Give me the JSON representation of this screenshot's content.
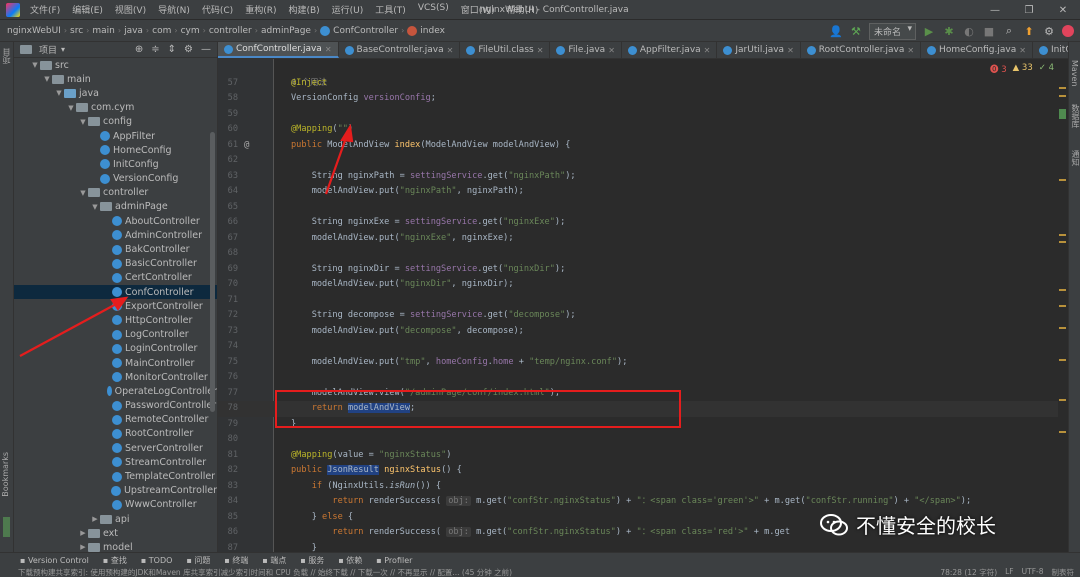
{
  "menu": [
    "文件(F)",
    "编辑(E)",
    "视图(V)",
    "导航(N)",
    "代码(C)",
    "重构(R)",
    "构建(B)",
    "运行(U)",
    "工具(T)",
    "VCS(S)",
    "窗口(W)",
    "帮助(H)"
  ],
  "window_title": "nginxWebUI - ConfController.java",
  "breadcrumb": [
    "nginxWebUI",
    "src",
    "main",
    "java",
    "com",
    "cym",
    "controller",
    "adminPage",
    "ConfController",
    "index"
  ],
  "run_config": "未命名",
  "project_panel": {
    "title": "项目",
    "tree": [
      {
        "label": "src",
        "indent": 1,
        "type": "folder",
        "open": true
      },
      {
        "label": "main",
        "indent": 2,
        "type": "folder",
        "open": true
      },
      {
        "label": "java",
        "indent": 3,
        "type": "srcfolder",
        "open": true
      },
      {
        "label": "com.cym",
        "indent": 4,
        "type": "package",
        "open": true
      },
      {
        "label": "config",
        "indent": 5,
        "type": "package",
        "open": true
      },
      {
        "label": "AppFilter",
        "indent": 6,
        "type": "class"
      },
      {
        "label": "HomeConfig",
        "indent": 6,
        "type": "class"
      },
      {
        "label": "InitConfig",
        "indent": 6,
        "type": "class"
      },
      {
        "label": "VersionConfig",
        "indent": 6,
        "type": "class"
      },
      {
        "label": "controller",
        "indent": 5,
        "type": "package",
        "open": true
      },
      {
        "label": "adminPage",
        "indent": 6,
        "type": "package",
        "open": true
      },
      {
        "label": "AboutController",
        "indent": 7,
        "type": "class"
      },
      {
        "label": "AdminController",
        "indent": 7,
        "type": "class"
      },
      {
        "label": "BakController",
        "indent": 7,
        "type": "class"
      },
      {
        "label": "BasicController",
        "indent": 7,
        "type": "class"
      },
      {
        "label": "CertController",
        "indent": 7,
        "type": "class"
      },
      {
        "label": "ConfController",
        "indent": 7,
        "type": "class",
        "selected": true
      },
      {
        "label": "ExportController",
        "indent": 7,
        "type": "class"
      },
      {
        "label": "HttpController",
        "indent": 7,
        "type": "class"
      },
      {
        "label": "LogController",
        "indent": 7,
        "type": "class"
      },
      {
        "label": "LoginController",
        "indent": 7,
        "type": "class"
      },
      {
        "label": "MainController",
        "indent": 7,
        "type": "class"
      },
      {
        "label": "MonitorController",
        "indent": 7,
        "type": "class"
      },
      {
        "label": "OperateLogController",
        "indent": 7,
        "type": "class"
      },
      {
        "label": "PasswordController",
        "indent": 7,
        "type": "class"
      },
      {
        "label": "RemoteController",
        "indent": 7,
        "type": "class"
      },
      {
        "label": "RootController",
        "indent": 7,
        "type": "class"
      },
      {
        "label": "ServerController",
        "indent": 7,
        "type": "class"
      },
      {
        "label": "StreamController",
        "indent": 7,
        "type": "class"
      },
      {
        "label": "TemplateController",
        "indent": 7,
        "type": "class"
      },
      {
        "label": "UpstreamController",
        "indent": 7,
        "type": "class"
      },
      {
        "label": "WwwController",
        "indent": 7,
        "type": "class"
      },
      {
        "label": "api",
        "indent": 6,
        "type": "package",
        "open": false
      },
      {
        "label": "ext",
        "indent": 5,
        "type": "package",
        "open": false
      },
      {
        "label": "model",
        "indent": 5,
        "type": "package",
        "open": false
      }
    ]
  },
  "tabs": [
    {
      "label": "ConfController.java",
      "active": true,
      "icon": "class"
    },
    {
      "label": "BaseController.java",
      "icon": "class"
    },
    {
      "label": "FileUtil.class",
      "icon": "class"
    },
    {
      "label": "File.java",
      "icon": "class"
    },
    {
      "label": "AppFilter.java",
      "icon": "class"
    },
    {
      "label": "JarUtil.java",
      "icon": "class"
    },
    {
      "label": "RootController.java",
      "icon": "class"
    },
    {
      "label": "HomeConfig.java",
      "icon": "class"
    },
    {
      "label": "InitC",
      "icon": "class"
    }
  ],
  "inspections": {
    "errors": "3",
    "warnings": "33",
    "weak": "4"
  },
  "usage_hint": "4 个用法",
  "code_lines": [
    {
      "n": "57",
      "html": "<span class='ann'>@Inject</span>"
    },
    {
      "n": "58",
      "html": "VersionConfig <span class='var'>versionConfig</span>;"
    },
    {
      "n": "59",
      "html": ""
    },
    {
      "n": "60",
      "html": "<span class='ann'>@Mapping</span>(<span class='str'>\"\"</span>)"
    },
    {
      "n": "61",
      "html": "<span class='kw'>public</span> ModelAndView <span class='fn'>index</span>(ModelAndView modelAndView) {",
      "gutter": "@"
    },
    {
      "n": "62",
      "html": ""
    },
    {
      "n": "63",
      "html": "    String nginxPath = <span class='var'>settingService</span>.get(<span class='str'>\"nginxPath\"</span>);"
    },
    {
      "n": "64",
      "html": "    modelAndView.put(<span class='str'>\"nginxPath\"</span>, nginxPath);"
    },
    {
      "n": "65",
      "html": ""
    },
    {
      "n": "66",
      "html": "    String nginxExe = <span class='var'>settingService</span>.get(<span class='str'>\"nginxExe\"</span>);"
    },
    {
      "n": "67",
      "html": "    modelAndView.put(<span class='str'>\"nginxExe\"</span>, nginxExe);"
    },
    {
      "n": "68",
      "html": ""
    },
    {
      "n": "69",
      "html": "    String nginxDir = <span class='var'>settingService</span>.get(<span class='str'>\"nginxDir\"</span>);"
    },
    {
      "n": "70",
      "html": "    modelAndView.put(<span class='str'>\"nginxDir\"</span>, nginxDir);"
    },
    {
      "n": "71",
      "html": ""
    },
    {
      "n": "72",
      "html": "    String decompose = <span class='var'>settingService</span>.get(<span class='str'>\"decompose\"</span>);"
    },
    {
      "n": "73",
      "html": "    modelAndView.put(<span class='str'>\"decompose\"</span>, decompose);"
    },
    {
      "n": "74",
      "html": ""
    },
    {
      "n": "75",
      "html": "    modelAndView.put(<span class='str'>\"tmp\"</span>, <span class='var'>homeConfig</span>.<span class='var'>home</span> + <span class='str'>\"temp/nginx.conf\"</span>);"
    },
    {
      "n": "76",
      "html": ""
    },
    {
      "n": "77",
      "html": "    modelAndView.view(<span class='str'>\"/adminPage/conf/index.html\"</span>);"
    },
    {
      "n": "78",
      "html": "    <span class='kw'>return</span> <span class='hl'>modelAndView</span>;",
      "current": true
    },
    {
      "n": "79",
      "html": "}"
    },
    {
      "n": "80",
      "html": ""
    },
    {
      "n": "81",
      "html": "<span class='ann'>@Mapping</span>(value = <span class='str'>\"nginxStatus\"</span>)"
    },
    {
      "n": "82",
      "html": "<span class='kw'>public</span> <span class='hl'>JsonResult</span> <span class='fn'>nginxStatus</span>() {"
    },
    {
      "n": "83",
      "html": "    <span class='kw'>if</span> (NginxUtils.<i>isRun</i>()) {"
    },
    {
      "n": "84",
      "html": "        <span class='kw'>return</span> renderSuccess( <span class='param-hint'>obj:</span> m.get(<span class='str'>\"confStr.nginxStatus\"</span>) + <span class='str'>\"：&lt;span class='green'&gt;\"</span> + m.get(<span class='str'>\"confStr.running\"</span>) + <span class='str'>\"&lt;/span&gt;\"</span>);"
    },
    {
      "n": "85",
      "html": "    } <span class='kw'>else</span> {"
    },
    {
      "n": "86",
      "html": "        <span class='kw'>return</span> renderSuccess( <span class='param-hint'>obj:</span> m.get(<span class='str'>\"confStr.nginxStatus\"</span>) + <span class='str'>\"：&lt;span class='red'&gt;\"</span> + m.get"
    },
    {
      "n": "87",
      "html": "    }"
    }
  ],
  "left_strip_labels": [
    "项目",
    "Bookmarks"
  ],
  "right_strip_labels": [
    "Maven",
    "数据库",
    "通知"
  ],
  "bottom_tools": [
    "Version Control",
    "查找",
    "TODO",
    "问题",
    "终端",
    "端点",
    "服务",
    "依赖",
    "Profiler"
  ],
  "status_text": "下载预构建共享索引: 使用预构建的JDK和Maven 库共享索引减少索引时间和 CPU 负载 // 始终下载 // 下载一次 // 不再显示 // 配置... (45 分钟 之前)",
  "status_right": [
    "78:28 (12 字符)",
    "LF",
    "UTF-8",
    "制表符"
  ],
  "watermark": "不懂安全的校长",
  "colors": {
    "annotation_red": "#e51d1d",
    "accent": "#4a88c7"
  }
}
